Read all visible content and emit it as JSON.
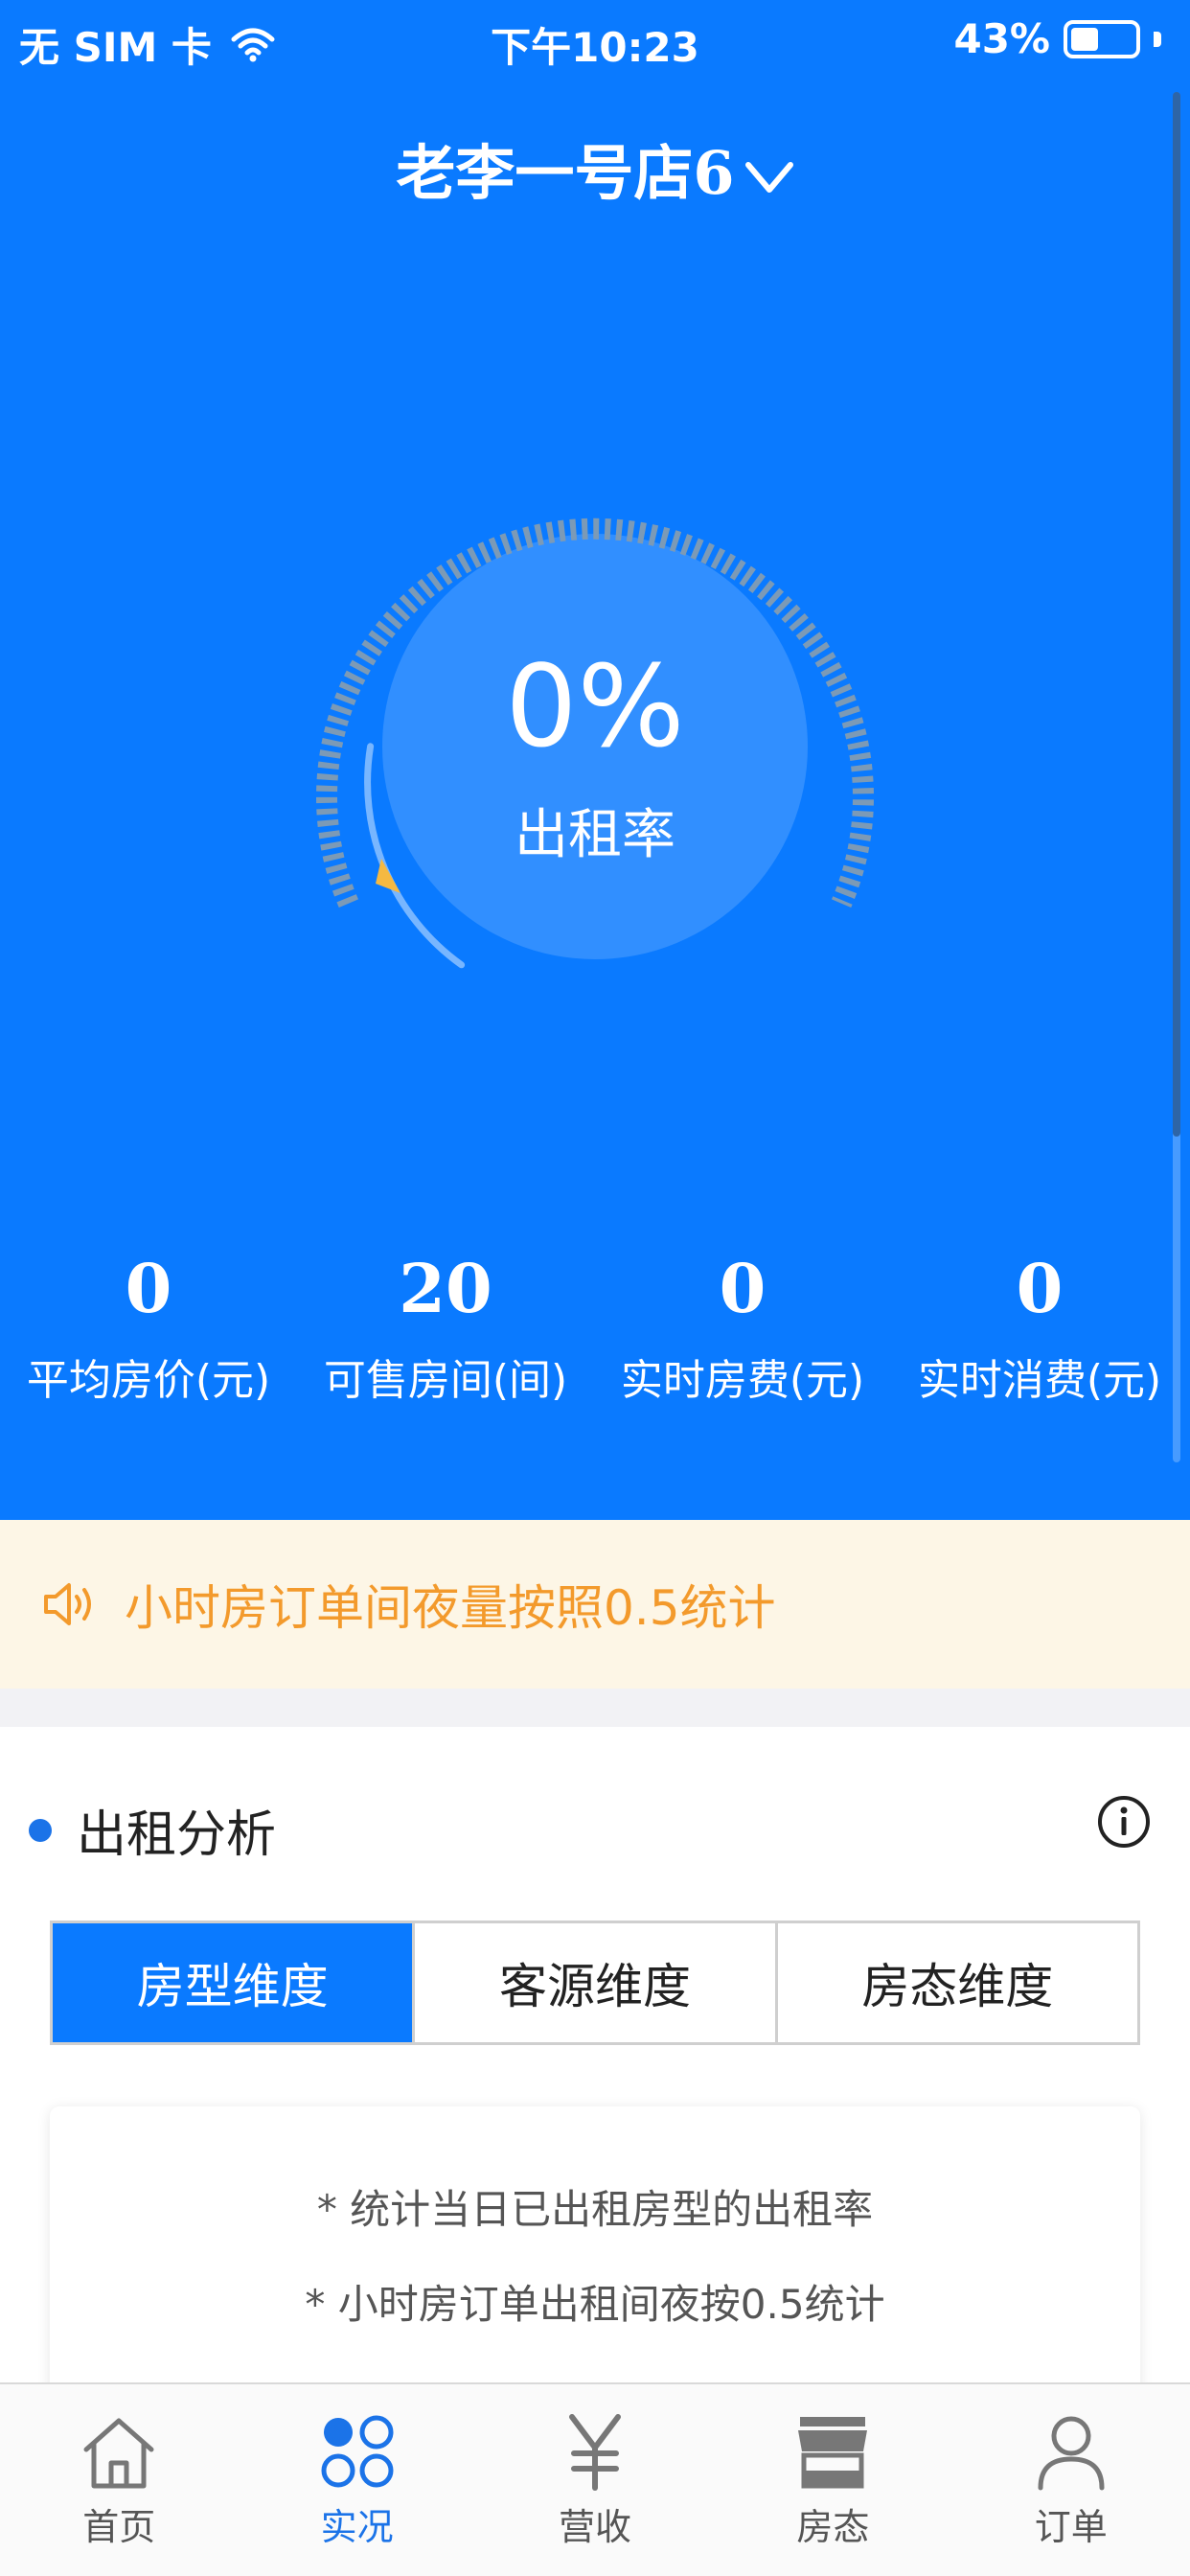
{
  "status_bar": {
    "carrier": "无 SIM 卡",
    "time": "下午10:23",
    "battery": "43%",
    "battery_level": 0.43
  },
  "header": {
    "store_name": "老李一号店6"
  },
  "occupancy": {
    "value": "0%",
    "label": "出租率"
  },
  "stats": [
    {
      "value": "0",
      "label": "平均房价(元)"
    },
    {
      "value": "20",
      "label": "可售房间(间)"
    },
    {
      "value": "0",
      "label": "实时房费(元)"
    },
    {
      "value": "0",
      "label": "实时消费(元)"
    }
  ],
  "notice": {
    "text": "小时房订单间夜量按照0.5统计"
  },
  "analysis": {
    "title": "出租分析",
    "tabs": [
      {
        "label": "房型维度"
      },
      {
        "label": "客源维度"
      },
      {
        "label": "房态维度"
      }
    ],
    "active_tab": 0,
    "notes": [
      "* 统计当日已出租房型的出租率",
      "* 小时房订单出租间夜按0.5统计"
    ]
  },
  "tabbar": {
    "items": [
      {
        "label": "首页"
      },
      {
        "label": "实况"
      },
      {
        "label": "营收"
      },
      {
        "label": "房态"
      },
      {
        "label": "订单"
      }
    ],
    "active": 1
  },
  "colors": {
    "primary": "#0a7aff",
    "notice_bg": "#fdf6e6",
    "notice_text": "#f39a2c",
    "indicator": "#f5b942"
  }
}
